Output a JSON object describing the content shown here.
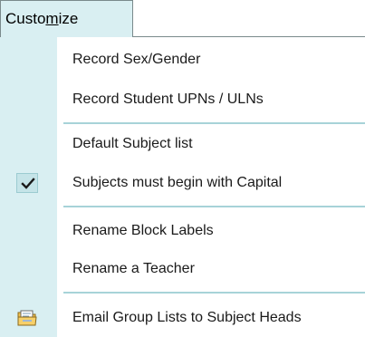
{
  "menubar": {
    "tab_pre": "Custo",
    "tab_underlined": "m",
    "tab_rest": "ize"
  },
  "menu": {
    "items": [
      {
        "label": "Record Sex/Gender"
      },
      {
        "label": "Record Student UPNs / ULNs"
      },
      {
        "label": "Default Subject list"
      },
      {
        "label": "Subjects must begin with Capital",
        "checked": true
      },
      {
        "label": "Rename Block Labels"
      },
      {
        "label": "Rename a Teacher"
      },
      {
        "label": "Email Group Lists to Subject Heads",
        "icon": "folder-mail-icon"
      }
    ]
  },
  "colors": {
    "menubar_bg": "#d9eff2",
    "gutter_bg": "#d9eff2",
    "separator": "#a7d3d8",
    "check_bg": "#c5e4e8"
  }
}
